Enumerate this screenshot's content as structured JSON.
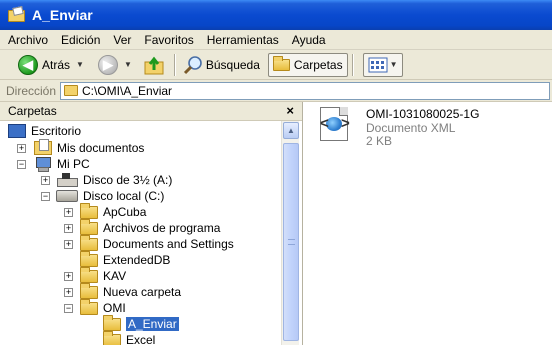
{
  "window": {
    "title": "A_Enviar"
  },
  "menu": [
    "Archivo",
    "Edición",
    "Ver",
    "Favoritos",
    "Herramientas",
    "Ayuda"
  ],
  "toolbar": {
    "back_label": "Atrás",
    "search_label": "Búsqueda",
    "folders_label": "Carpetas"
  },
  "address": {
    "label": "Dirección",
    "value": "C:\\OMI\\A_Enviar"
  },
  "folders_pane": {
    "title": "Carpetas",
    "close": "×",
    "tree": [
      {
        "label": "Escritorio"
      },
      {
        "label": "Mis documentos"
      },
      {
        "label": "Mi PC"
      },
      {
        "label": "Disco de 3½ (A:)"
      },
      {
        "label": "Disco local (C:)"
      },
      {
        "label": "ApCuba"
      },
      {
        "label": "Archivos de programa"
      },
      {
        "label": "Documents and Settings"
      },
      {
        "label": "ExtendedDB"
      },
      {
        "label": "KAV"
      },
      {
        "label": "Nueva carpeta"
      },
      {
        "label": "OMI"
      },
      {
        "label": "A_Enviar",
        "selected": true
      },
      {
        "label": "Excel"
      }
    ]
  },
  "files": [
    {
      "name": "OMI-1031080025-1G",
      "type": "Documento XML",
      "size": "2 KB"
    }
  ],
  "colors": {
    "titlebar": "#0a4ad0",
    "selection": "#316ac5",
    "chrome": "#ece9d8"
  }
}
